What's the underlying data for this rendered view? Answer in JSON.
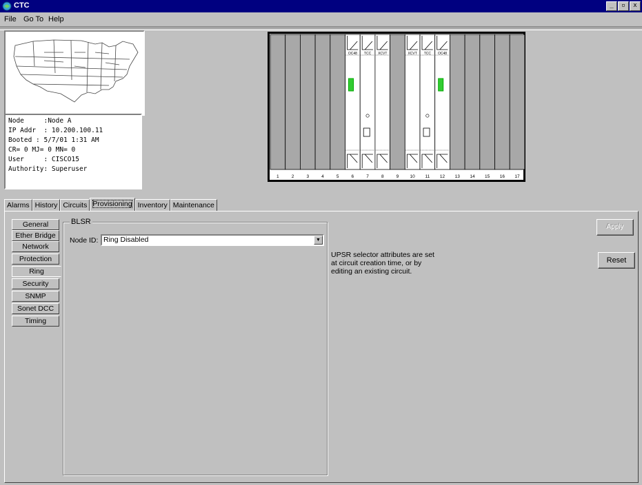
{
  "window": {
    "title": "CTC"
  },
  "menu": [
    "File",
    "Go To",
    "Help"
  ],
  "node_info": [
    "Node     :Node A",
    "IP Addr  : 10.200.100.11",
    "Booted : 5/7/01 1:31 AM",
    "CR= 0 MJ= 0 MN= 0",
    "User     : CISCO15",
    "Authority: Superuser"
  ],
  "shelf": {
    "slot_numbers": [
      "1",
      "2",
      "3",
      "4",
      "5",
      "6",
      "7",
      "8",
      "9",
      "10",
      "11",
      "12",
      "13",
      "14",
      "15",
      "16",
      "17"
    ],
    "card_labels": {
      "slot6": "OC48",
      "slot7": "TCC",
      "slot8": "XCVT",
      "slot10": "XCVT",
      "slot11": "TCC",
      "slot12": "OC48"
    },
    "colors": {
      "empty_slot": "#a8a8a8",
      "card": "#ffffff",
      "active_led": "#33cc33"
    }
  },
  "tabs": [
    "Alarms",
    "History",
    "Circuits",
    "Provisioning",
    "Inventory",
    "Maintenance"
  ],
  "active_tab": "Provisioning",
  "subtabs": [
    "General",
    "Ether Bridge",
    "Network",
    "Protection",
    "Ring",
    "Security",
    "SNMP",
    "Sonet DCC",
    "Timing"
  ],
  "active_subtab": "Ring",
  "blsr": {
    "group_title": "BLSR",
    "node_id_label": "Node ID:",
    "node_id_value": "Ring Disabled"
  },
  "description": [
    "UPSR selector attributes are set",
    "at circuit creation time, or by",
    "editing an existing circuit."
  ],
  "buttons": {
    "apply": "Apply",
    "reset": "Reset"
  }
}
